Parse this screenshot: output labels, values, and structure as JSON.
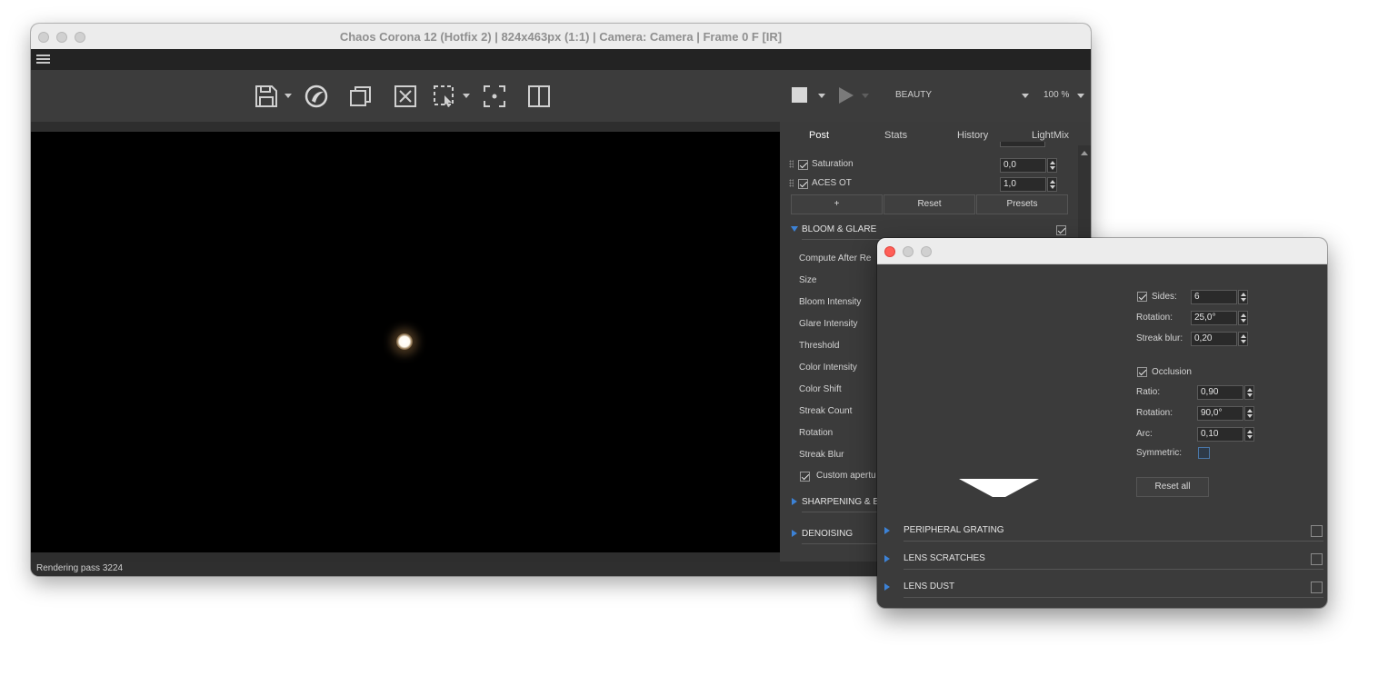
{
  "main_window": {
    "title": "Chaos Corona 12 (Hotfix 2) | 824x463px (1:1) | Camera: Camera | Frame 0 F [IR]",
    "toolbar": {
      "render_element": "BEAUTY",
      "zoom": "100 %"
    },
    "tabs": [
      "Post",
      "Stats",
      "History",
      "LightMix"
    ],
    "post": {
      "operators": [
        {
          "label": "Saturation",
          "value": "0,0"
        },
        {
          "label": "ACES OT",
          "value": "1,0"
        }
      ],
      "buttons": {
        "add": "+",
        "reset": "Reset",
        "presets": "Presets"
      },
      "bloom_glare": {
        "header": "BLOOM & GLARE",
        "items": [
          "Compute After Re",
          "Size",
          "Bloom Intensity",
          "Glare Intensity",
          "Threshold",
          "Color Intensity",
          "Color Shift",
          "Streak Count",
          "Rotation",
          "Streak Blur"
        ],
        "custom_aperture": "Custom apertu"
      },
      "sharpening": "SHARPENING & B",
      "denoising": "DENOISING"
    },
    "status": "Rendering pass 3224"
  },
  "aperture_window": {
    "sides_label": "Sides:",
    "sides_value": "6",
    "rotation_label": "Rotation:",
    "rotation_value": "25,0°",
    "streak_blur_label": "Streak blur:",
    "streak_blur_value": "0,20",
    "occlusion_label": "Occlusion",
    "ratio_label": "Ratio:",
    "ratio_value": "0,90",
    "occ_rotation_label": "Rotation:",
    "occ_rotation_value": "90,0°",
    "arc_label": "Arc:",
    "arc_value": "0,10",
    "symmetric_label": "Symmetric:",
    "reset_all": "Reset all",
    "sections": [
      "PERIPHERAL GRATING",
      "LENS SCRATCHES",
      "LENS DUST"
    ]
  },
  "colors": {
    "accent_blue": "#3c82d6",
    "close_red": "#ff5f57"
  }
}
